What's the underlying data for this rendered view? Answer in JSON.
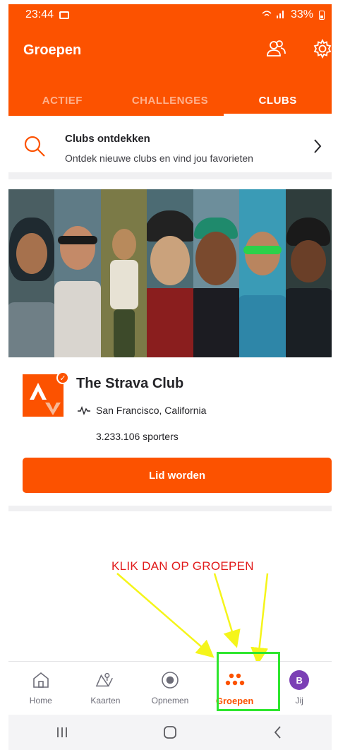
{
  "status_bar": {
    "time": "23:44",
    "battery": "33%"
  },
  "header": {
    "title": "Groepen"
  },
  "tabs": [
    {
      "label": "ACTIEF",
      "active": false
    },
    {
      "label": "CHALLENGES",
      "active": false
    },
    {
      "label": "CLUBS",
      "active": true
    }
  ],
  "discover": {
    "title": "Clubs ontdekken",
    "subtitle": "Ontdek nieuwe clubs en vind jou favorieten"
  },
  "club": {
    "name": "The Strava Club",
    "location": "San Francisco, California",
    "members": "3.233.106 sporters",
    "join_label": "Lid worden"
  },
  "annotation": {
    "text": "KLIK DAN OP GROEPEN",
    "color": "#e11a1a"
  },
  "bottom_nav": [
    {
      "label": "Home",
      "icon": "home-icon",
      "active": false
    },
    {
      "label": "Kaarten",
      "icon": "map-icon",
      "active": false
    },
    {
      "label": "Opnemen",
      "icon": "record-icon",
      "active": false
    },
    {
      "label": "Groepen",
      "icon": "groups-icon",
      "active": true
    },
    {
      "label": "Jij",
      "icon": "avatar",
      "avatar_letter": "B",
      "active": false
    }
  ],
  "colors": {
    "brand": "#fc5200",
    "highlight": "#2ee62e",
    "arrow": "#f5f51a",
    "avatar": "#7b3fb5"
  }
}
